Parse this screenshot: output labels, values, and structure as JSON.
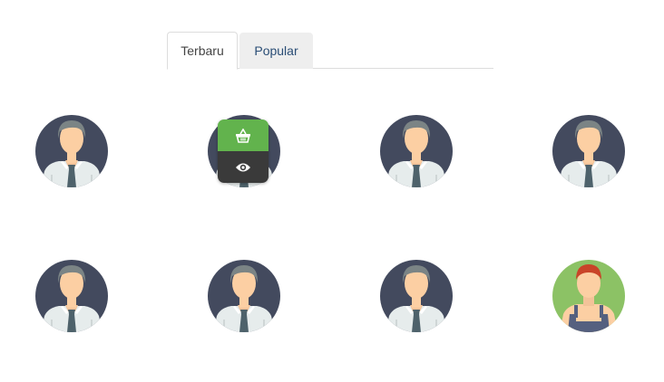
{
  "tabs": [
    {
      "label": "Terbaru",
      "active": true
    },
    {
      "label": "Popular",
      "active": false
    }
  ],
  "products": [
    {
      "avatar": "businessman-avatar"
    },
    {
      "avatar": "businessman-avatar"
    },
    {
      "avatar": "businessman-avatar"
    },
    {
      "avatar": "businessman-avatar"
    },
    {
      "avatar": "businessman-avatar"
    },
    {
      "avatar": "businessman-avatar"
    },
    {
      "avatar": "businessman-avatar"
    },
    {
      "avatar": "worker-avatar"
    }
  ],
  "hover_actions": [
    {
      "icon": "basket-icon",
      "color": "#62b34d"
    },
    {
      "icon": "eye-icon",
      "color": "#3a3a3a"
    }
  ],
  "colors": {
    "avatar_bg": "#434a5e",
    "worker_bg": "#8cc265",
    "skin": "#fccfa3",
    "hair": "#7b8485",
    "worker_hair": "#c94428",
    "shirt": "#e6ecec",
    "tie": "#4e626b",
    "overalls": "#55607f"
  }
}
